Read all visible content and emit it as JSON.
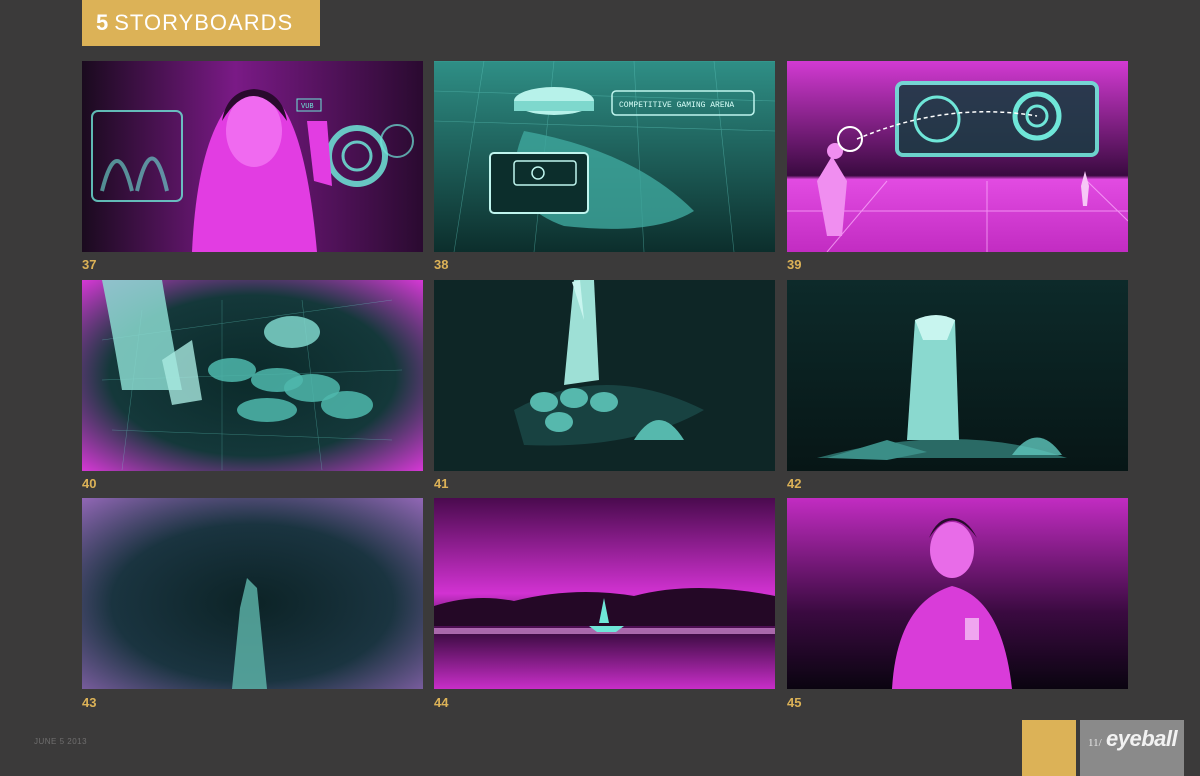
{
  "header": {
    "section_number": "5",
    "section_title": "STORYBOARDS"
  },
  "frames": [
    {
      "number": "37",
      "caption": "VUB"
    },
    {
      "number": "38",
      "caption": "COMPETITIVE GAMING ARENA"
    },
    {
      "number": "39"
    },
    {
      "number": "40"
    },
    {
      "number": "41"
    },
    {
      "number": "42"
    },
    {
      "number": "43"
    },
    {
      "number": "44"
    },
    {
      "number": "45"
    }
  ],
  "footer": {
    "date": "JUNE 5 2013",
    "page_number": "11/",
    "brand": "eyeball"
  },
  "colors": {
    "accent_gold": "#dcb257",
    "magenta": "#d61ed6",
    "cyan": "#6fe6d8",
    "background": "#3b3a3a"
  }
}
